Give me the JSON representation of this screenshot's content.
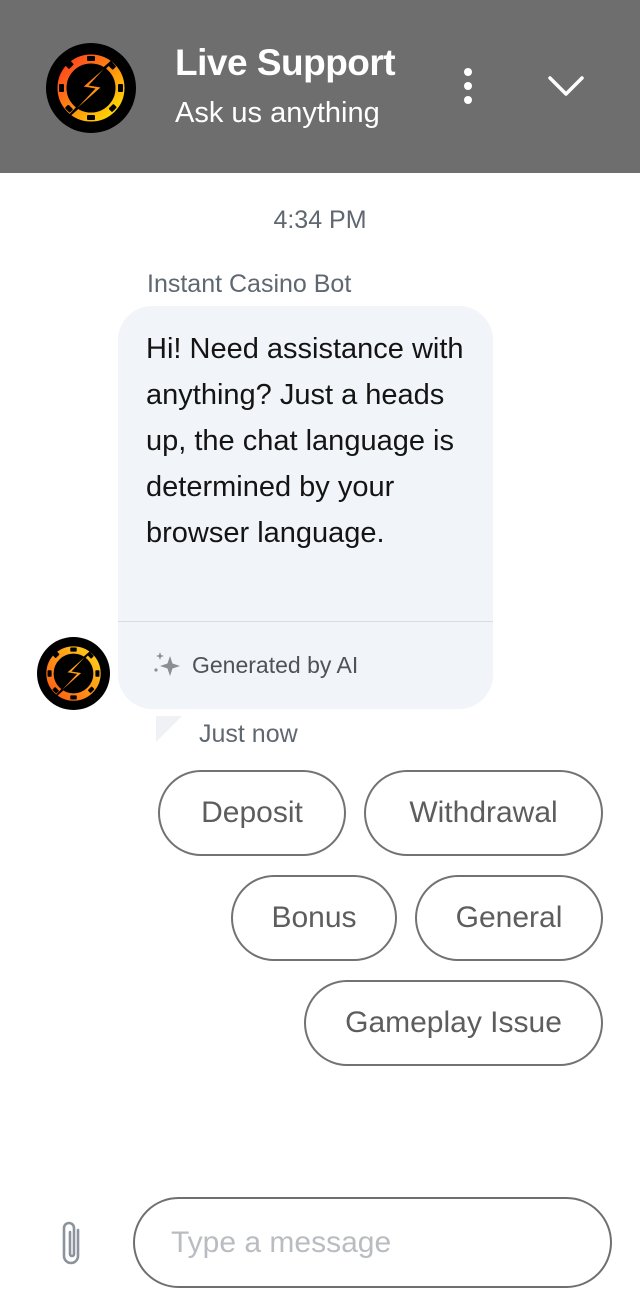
{
  "header": {
    "title": "Live Support",
    "subtitle": "Ask us anything",
    "logo_icon": "lightning-casino-chip-logo",
    "menu_icon": "more-vertical-icon",
    "collapse_icon": "chevron-down-icon",
    "background_color": "#6e6e6e"
  },
  "conversation": {
    "timestamp": "4:34 PM",
    "messages": [
      {
        "sender": "Instant Casino Bot",
        "text": "Hi! Need assistance with anything? Just a heads up, the chat language is determined by your browser language.",
        "badge": "Generated by AI",
        "badge_icon": "sparkles-icon",
        "time": "Just now",
        "avatar_icon": "lightning-casino-chip-logo"
      }
    ],
    "quick_replies": [
      {
        "label": "Deposit"
      },
      {
        "label": "Withdrawal"
      },
      {
        "label": "Bonus"
      },
      {
        "label": "General"
      },
      {
        "label": "Gameplay Issue"
      }
    ]
  },
  "composer": {
    "attach_icon": "paperclip-icon",
    "placeholder": "Type a message",
    "value": ""
  },
  "colors": {
    "bubble_background": "#f1f4f8",
    "chip_border": "#727272",
    "logo_gradient_start": "#ff4a1a",
    "logo_gradient_end": "#ffe600"
  }
}
